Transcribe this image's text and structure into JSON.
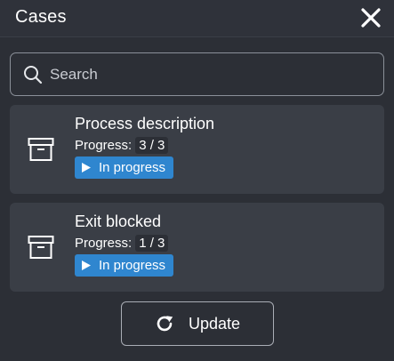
{
  "header": {
    "title": "Cases"
  },
  "search": {
    "placeholder": "Search",
    "value": ""
  },
  "cases": [
    {
      "title": "Process description",
      "progress_label": "Progress:",
      "progress_value": "3 / 3",
      "progress_fraction": 1.0,
      "status": "In progress",
      "icon": "archive-box-icon"
    },
    {
      "title": "Exit blocked",
      "progress_label": "Progress:",
      "progress_value": "1 / 3",
      "progress_fraction": 0.333,
      "status": "In progress",
      "icon": "archive-box-icon"
    }
  ],
  "footer": {
    "update_label": "Update"
  },
  "colors": {
    "background": "#2c2f36",
    "card": "#3a3e46",
    "status_badge": "#2f86cf",
    "text": "#ffffff"
  },
  "icons": {
    "close": "close-icon",
    "search": "search-icon",
    "status": "play-icon",
    "update": "refresh-icon"
  }
}
